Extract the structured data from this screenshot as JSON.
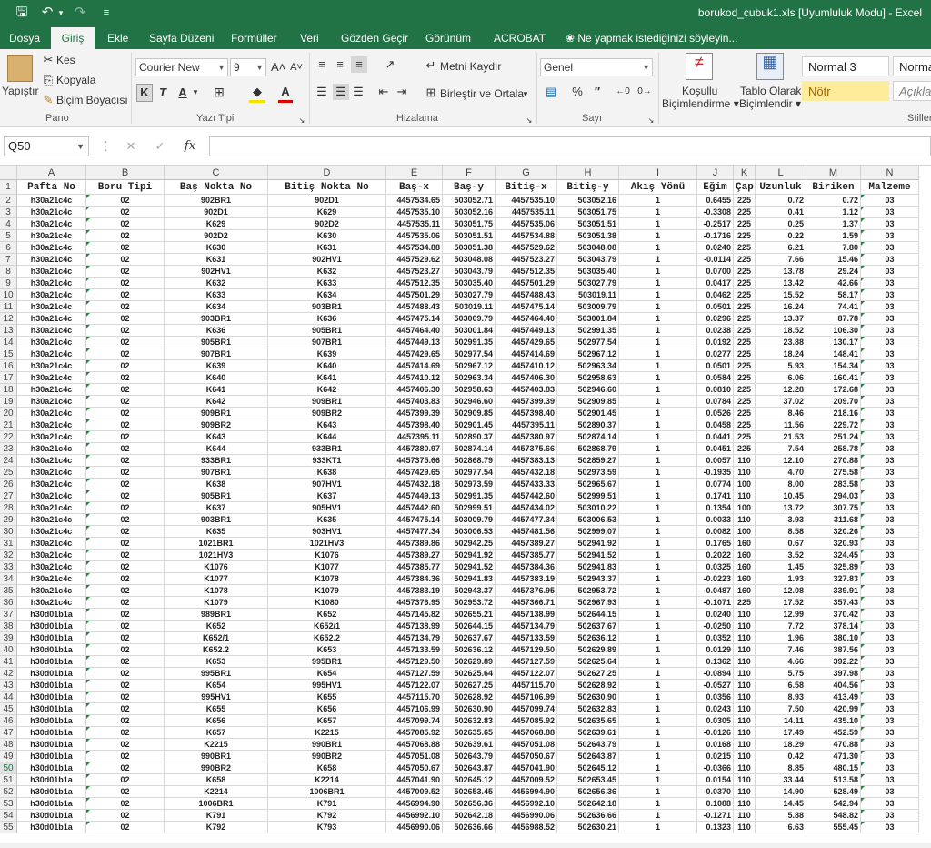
{
  "window": {
    "title": "borukod_cubuk1.xls  [Uyumluluk Modu] - Excel"
  },
  "tabs": [
    "Dosya",
    "Giriş",
    "Ekle",
    "Sayfa Düzeni",
    "Formüller",
    "Veri",
    "Gözden Geçir",
    "Görünüm",
    "ACROBAT",
    "Ne yapmak istediğinizi söyleyin..."
  ],
  "ribbon": {
    "clipboard": {
      "paste": "Yapıştır",
      "cut": "Kes",
      "copy": "Kopyala",
      "format_painter": "Biçim Boyacısı",
      "label": "Pano"
    },
    "font": {
      "name": "Courier New",
      "size": "9",
      "bold": "K",
      "italic": "T",
      "underline": "A",
      "label": "Yazı Tipi"
    },
    "alignment": {
      "wrap": "Metni Kaydır",
      "merge": "Birleştir ve Ortala",
      "label": "Hizalama"
    },
    "number": {
      "format": "Genel",
      "label": "Sayı"
    },
    "styles": {
      "conditional": "Koşullu\nBiçimlendirme",
      "cond_l1": "Koşullu",
      "cond_l2": "Biçimlendirme",
      "table_l1": "Tablo Olarak",
      "table_l2": "Biçimlendir",
      "normal3": "Normal 3",
      "normal": "Norma",
      "notr": "Nötr",
      "aciklama": "Açıklar",
      "label": "Stiller"
    }
  },
  "formula_bar": {
    "name_box": "Q50",
    "fx": "fx"
  },
  "columns": [
    "A",
    "B",
    "C",
    "D",
    "E",
    "F",
    "G",
    "H",
    "I",
    "J",
    "K",
    "L",
    "M",
    "N"
  ],
  "header_row": [
    "Pafta No",
    "Boru Tipi",
    "Baş Nokta No",
    "Bitiş Nokta No",
    "Baş-x",
    "Baş-y",
    "Bitiş-x",
    "Bitiş-y",
    "Akış Yönü",
    "Eğim",
    "Çap",
    "Uzunluk",
    "Biriken",
    "Malzeme"
  ],
  "rows": [
    [
      "h30a21c4c",
      "02",
      "902BR1",
      "902D1",
      "4457534.65",
      "503052.71",
      "4457535.10",
      "503052.16",
      "1",
      "0.6455",
      "225",
      "0.72",
      "0.72",
      "03"
    ],
    [
      "h30a21c4c",
      "02",
      "902D1",
      "K629",
      "4457535.10",
      "503052.16",
      "4457535.11",
      "503051.75",
      "1",
      "-0.3308",
      "225",
      "0.41",
      "1.12",
      "03"
    ],
    [
      "h30a21c4c",
      "02",
      "K629",
      "902D2",
      "4457535.11",
      "503051.75",
      "4457535.06",
      "503051.51",
      "1",
      "-0.2517",
      "225",
      "0.25",
      "1.37",
      "03"
    ],
    [
      "h30a21c4c",
      "02",
      "902D2",
      "K630",
      "4457535.06",
      "503051.51",
      "4457534.88",
      "503051.38",
      "1",
      "-0.1716",
      "225",
      "0.22",
      "1.59",
      "03"
    ],
    [
      "h30a21c4c",
      "02",
      "K630",
      "K631",
      "4457534.88",
      "503051.38",
      "4457529.62",
      "503048.08",
      "1",
      "0.0240",
      "225",
      "6.21",
      "7.80",
      "03"
    ],
    [
      "h30a21c4c",
      "02",
      "K631",
      "902HV1",
      "4457529.62",
      "503048.08",
      "4457523.27",
      "503043.79",
      "1",
      "-0.0114",
      "225",
      "7.66",
      "15.46",
      "03"
    ],
    [
      "h30a21c4c",
      "02",
      "902HV1",
      "K632",
      "4457523.27",
      "503043.79",
      "4457512.35",
      "503035.40",
      "1",
      "0.0700",
      "225",
      "13.78",
      "29.24",
      "03"
    ],
    [
      "h30a21c4c",
      "02",
      "K632",
      "K633",
      "4457512.35",
      "503035.40",
      "4457501.29",
      "503027.79",
      "1",
      "0.0417",
      "225",
      "13.42",
      "42.66",
      "03"
    ],
    [
      "h30a21c4c",
      "02",
      "K633",
      "K634",
      "4457501.29",
      "503027.79",
      "4457488.43",
      "503019.11",
      "1",
      "0.0462",
      "225",
      "15.52",
      "58.17",
      "03"
    ],
    [
      "h30a21c4c",
      "02",
      "K634",
      "903BR1",
      "4457488.43",
      "503019.11",
      "4457475.14",
      "503009.79",
      "1",
      "0.0501",
      "225",
      "16.24",
      "74.41",
      "03"
    ],
    [
      "h30a21c4c",
      "02",
      "903BR1",
      "K636",
      "4457475.14",
      "503009.79",
      "4457464.40",
      "503001.84",
      "1",
      "0.0296",
      "225",
      "13.37",
      "87.78",
      "03"
    ],
    [
      "h30a21c4c",
      "02",
      "K636",
      "905BR1",
      "4457464.40",
      "503001.84",
      "4457449.13",
      "502991.35",
      "1",
      "0.0238",
      "225",
      "18.52",
      "106.30",
      "03"
    ],
    [
      "h30a21c4c",
      "02",
      "905BR1",
      "907BR1",
      "4457449.13",
      "502991.35",
      "4457429.65",
      "502977.54",
      "1",
      "0.0192",
      "225",
      "23.88",
      "130.17",
      "03"
    ],
    [
      "h30a21c4c",
      "02",
      "907BR1",
      "K639",
      "4457429.65",
      "502977.54",
      "4457414.69",
      "502967.12",
      "1",
      "0.0277",
      "225",
      "18.24",
      "148.41",
      "03"
    ],
    [
      "h30a21c4c",
      "02",
      "K639",
      "K640",
      "4457414.69",
      "502967.12",
      "4457410.12",
      "502963.34",
      "1",
      "0.0501",
      "225",
      "5.93",
      "154.34",
      "03"
    ],
    [
      "h30a21c4c",
      "02",
      "K640",
      "K641",
      "4457410.12",
      "502963.34",
      "4457406.30",
      "502958.63",
      "1",
      "0.0584",
      "225",
      "6.06",
      "160.41",
      "03"
    ],
    [
      "h30a21c4c",
      "02",
      "K641",
      "K642",
      "4457406.30",
      "502958.63",
      "4457403.83",
      "502946.60",
      "1",
      "0.0810",
      "225",
      "12.28",
      "172.68",
      "03"
    ],
    [
      "h30a21c4c",
      "02",
      "K642",
      "909BR1",
      "4457403.83",
      "502946.60",
      "4457399.39",
      "502909.85",
      "1",
      "0.0784",
      "225",
      "37.02",
      "209.70",
      "03"
    ],
    [
      "h30a21c4c",
      "02",
      "909BR1",
      "909BR2",
      "4457399.39",
      "502909.85",
      "4457398.40",
      "502901.45",
      "1",
      "0.0526",
      "225",
      "8.46",
      "218.16",
      "03"
    ],
    [
      "h30a21c4c",
      "02",
      "909BR2",
      "K643",
      "4457398.40",
      "502901.45",
      "4457395.11",
      "502890.37",
      "1",
      "0.0458",
      "225",
      "11.56",
      "229.72",
      "03"
    ],
    [
      "h30a21c4c",
      "02",
      "K643",
      "K644",
      "4457395.11",
      "502890.37",
      "4457380.97",
      "502874.14",
      "1",
      "0.0441",
      "225",
      "21.53",
      "251.24",
      "03"
    ],
    [
      "h30a21c4c",
      "02",
      "K644",
      "933BR1",
      "4457380.97",
      "502874.14",
      "4457375.66",
      "502868.79",
      "1",
      "0.0451",
      "225",
      "7.54",
      "258.78",
      "03"
    ],
    [
      "h30a21c4c",
      "02",
      "933BR1",
      "933KT1",
      "4457375.66",
      "502868.79",
      "4457383.13",
      "502859.27",
      "1",
      "0.0057",
      "110",
      "12.10",
      "270.88",
      "03"
    ],
    [
      "h30a21c4c",
      "02",
      "907BR1",
      "K638",
      "4457429.65",
      "502977.54",
      "4457432.18",
      "502973.59",
      "1",
      "-0.1935",
      "110",
      "4.70",
      "275.58",
      "03"
    ],
    [
      "h30a21c4c",
      "02",
      "K638",
      "907HV1",
      "4457432.18",
      "502973.59",
      "4457433.33",
      "502965.67",
      "1",
      "0.0774",
      "100",
      "8.00",
      "283.58",
      "03"
    ],
    [
      "h30a21c4c",
      "02",
      "905BR1",
      "K637",
      "4457449.13",
      "502991.35",
      "4457442.60",
      "502999.51",
      "1",
      "0.1741",
      "110",
      "10.45",
      "294.03",
      "03"
    ],
    [
      "h30a21c4c",
      "02",
      "K637",
      "905HV1",
      "4457442.60",
      "502999.51",
      "4457434.02",
      "503010.22",
      "1",
      "0.1354",
      "100",
      "13.72",
      "307.75",
      "03"
    ],
    [
      "h30a21c4c",
      "02",
      "903BR1",
      "K635",
      "4457475.14",
      "503009.79",
      "4457477.34",
      "503006.53",
      "1",
      "0.0033",
      "110",
      "3.93",
      "311.68",
      "03"
    ],
    [
      "h30a21c4c",
      "02",
      "K635",
      "903HV1",
      "4457477.34",
      "503006.53",
      "4457481.56",
      "502999.07",
      "1",
      "0.0082",
      "100",
      "8.58",
      "320.26",
      "03"
    ],
    [
      "h30a21c4c",
      "02",
      "1021BR1",
      "1021HV3",
      "4457389.86",
      "502942.25",
      "4457389.27",
      "502941.92",
      "1",
      "0.1765",
      "160",
      "0.67",
      "320.93",
      "03"
    ],
    [
      "h30a21c4c",
      "02",
      "1021HV3",
      "K1076",
      "4457389.27",
      "502941.92",
      "4457385.77",
      "502941.52",
      "1",
      "0.2022",
      "160",
      "3.52",
      "324.45",
      "03"
    ],
    [
      "h30a21c4c",
      "02",
      "K1076",
      "K1077",
      "4457385.77",
      "502941.52",
      "4457384.36",
      "502941.83",
      "1",
      "0.0325",
      "160",
      "1.45",
      "325.89",
      "03"
    ],
    [
      "h30a21c4c",
      "02",
      "K1077",
      "K1078",
      "4457384.36",
      "502941.83",
      "4457383.19",
      "502943.37",
      "1",
      "-0.0223",
      "160",
      "1.93",
      "327.83",
      "03"
    ],
    [
      "h30a21c4c",
      "02",
      "K1078",
      "K1079",
      "4457383.19",
      "502943.37",
      "4457376.95",
      "502953.72",
      "1",
      "-0.0487",
      "160",
      "12.08",
      "339.91",
      "03"
    ],
    [
      "h30a21c4c",
      "02",
      "K1079",
      "K1080",
      "4457376.95",
      "502953.72",
      "4457366.71",
      "502967.93",
      "1",
      "-0.1071",
      "225",
      "17.52",
      "357.43",
      "03"
    ],
    [
      "h30d01b1a",
      "02",
      "989BR1",
      "K652",
      "4457145.82",
      "502655.21",
      "4457138.99",
      "502644.15",
      "1",
      "0.0240",
      "110",
      "12.99",
      "370.42",
      "03"
    ],
    [
      "h30d01b1a",
      "02",
      "K652",
      "K652/1",
      "4457138.99",
      "502644.15",
      "4457134.79",
      "502637.67",
      "1",
      "-0.0250",
      "110",
      "7.72",
      "378.14",
      "03"
    ],
    [
      "h30d01b1a",
      "02",
      "K652/1",
      "K652.2",
      "4457134.79",
      "502637.67",
      "4457133.59",
      "502636.12",
      "1",
      "0.0352",
      "110",
      "1.96",
      "380.10",
      "03"
    ],
    [
      "h30d01b1a",
      "02",
      "K652.2",
      "K653",
      "4457133.59",
      "502636.12",
      "4457129.50",
      "502629.89",
      "1",
      "0.0129",
      "110",
      "7.46",
      "387.56",
      "03"
    ],
    [
      "h30d01b1a",
      "02",
      "K653",
      "995BR1",
      "4457129.50",
      "502629.89",
      "4457127.59",
      "502625.64",
      "1",
      "0.1362",
      "110",
      "4.66",
      "392.22",
      "03"
    ],
    [
      "h30d01b1a",
      "02",
      "995BR1",
      "K654",
      "4457127.59",
      "502625.64",
      "4457122.07",
      "502627.25",
      "1",
      "-0.0894",
      "110",
      "5.75",
      "397.98",
      "03"
    ],
    [
      "h30d01b1a",
      "02",
      "K654",
      "995HV1",
      "4457122.07",
      "502627.25",
      "4457115.70",
      "502628.92",
      "1",
      "-0.0527",
      "110",
      "6.58",
      "404.56",
      "03"
    ],
    [
      "h30d01b1a",
      "02",
      "995HV1",
      "K655",
      "4457115.70",
      "502628.92",
      "4457106.99",
      "502630.90",
      "1",
      "0.0356",
      "110",
      "8.93",
      "413.49",
      "03"
    ],
    [
      "h30d01b1a",
      "02",
      "K655",
      "K656",
      "4457106.99",
      "502630.90",
      "4457099.74",
      "502632.83",
      "1",
      "0.0243",
      "110",
      "7.50",
      "420.99",
      "03"
    ],
    [
      "h30d01b1a",
      "02",
      "K656",
      "K657",
      "4457099.74",
      "502632.83",
      "4457085.92",
      "502635.65",
      "1",
      "0.0305",
      "110",
      "14.11",
      "435.10",
      "03"
    ],
    [
      "h30d01b1a",
      "02",
      "K657",
      "K2215",
      "4457085.92",
      "502635.65",
      "4457068.88",
      "502639.61",
      "1",
      "-0.0126",
      "110",
      "17.49",
      "452.59",
      "03"
    ],
    [
      "h30d01b1a",
      "02",
      "K2215",
      "990BR1",
      "4457068.88",
      "502639.61",
      "4457051.08",
      "502643.79",
      "1",
      "0.0168",
      "110",
      "18.29",
      "470.88",
      "03"
    ],
    [
      "h30d01b1a",
      "02",
      "990BR1",
      "990BR2",
      "4457051.08",
      "502643.79",
      "4457050.67",
      "502643.87",
      "1",
      "0.0215",
      "110",
      "0.42",
      "471.30",
      "03"
    ],
    [
      "h30d01b1a",
      "02",
      "990BR2",
      "K658",
      "4457050.67",
      "502643.87",
      "4457041.90",
      "502645.12",
      "1",
      "-0.0366",
      "110",
      "8.85",
      "480.15",
      "03"
    ],
    [
      "h30d01b1a",
      "02",
      "K658",
      "K2214",
      "4457041.90",
      "502645.12",
      "4457009.52",
      "502653.45",
      "1",
      "0.0154",
      "110",
      "33.44",
      "513.58",
      "03"
    ],
    [
      "h30d01b1a",
      "02",
      "K2214",
      "1006BR1",
      "4457009.52",
      "502653.45",
      "4456994.90",
      "502656.36",
      "1",
      "-0.0370",
      "110",
      "14.90",
      "528.49",
      "03"
    ],
    [
      "h30d01b1a",
      "02",
      "1006BR1",
      "K791",
      "4456994.90",
      "502656.36",
      "4456992.10",
      "502642.18",
      "1",
      "0.1088",
      "110",
      "14.45",
      "542.94",
      "03"
    ],
    [
      "h30d01b1a",
      "02",
      "K791",
      "K792",
      "4456992.10",
      "502642.18",
      "4456990.06",
      "502636.66",
      "1",
      "-0.1271",
      "110",
      "5.88",
      "548.82",
      "03"
    ],
    [
      "h30d01b1a",
      "02",
      "K792",
      "K793",
      "4456990.06",
      "502636.66",
      "4456988.52",
      "502630.21",
      "1",
      "0.1323",
      "110",
      "6.63",
      "555.45",
      "03"
    ]
  ]
}
